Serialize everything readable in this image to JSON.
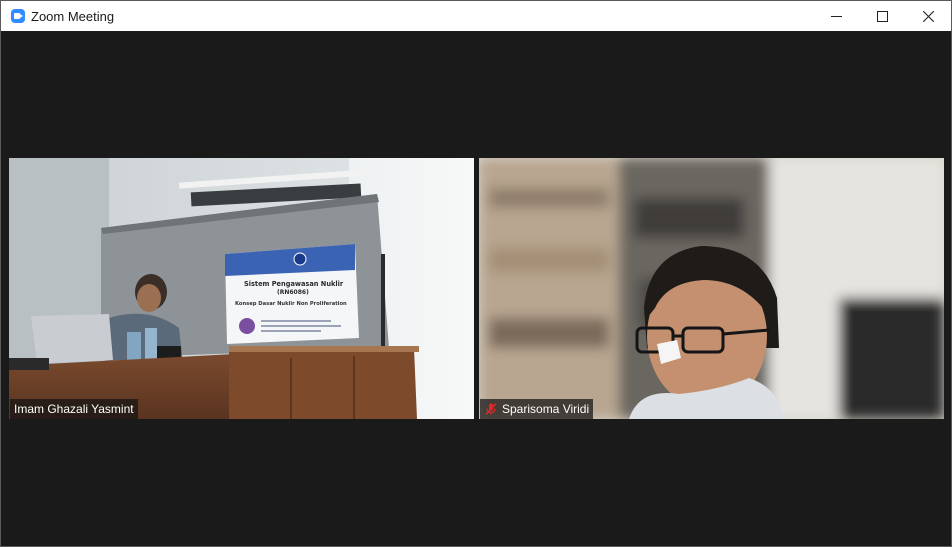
{
  "window": {
    "title": "Zoom Meeting",
    "controls": [
      "minimize",
      "maximize",
      "close"
    ]
  },
  "participants": [
    {
      "name": "Imam Ghazali Yasmint",
      "muted": false,
      "slide": {
        "title": "Sistem Pengawasan Nuklir",
        "code": "(RN6086)",
        "subtitle": "Konsep Dasar Nuklir Non Proliferation"
      }
    },
    {
      "name": "Sparisoma Viridi",
      "muted": true,
      "mute_icon": "microphone-muted-icon",
      "mute_color": "#e02828"
    }
  ],
  "colors": {
    "titlebar": "#ffffff",
    "stage": "#1a1a1a",
    "zoom_blue": "#2d8cff"
  }
}
